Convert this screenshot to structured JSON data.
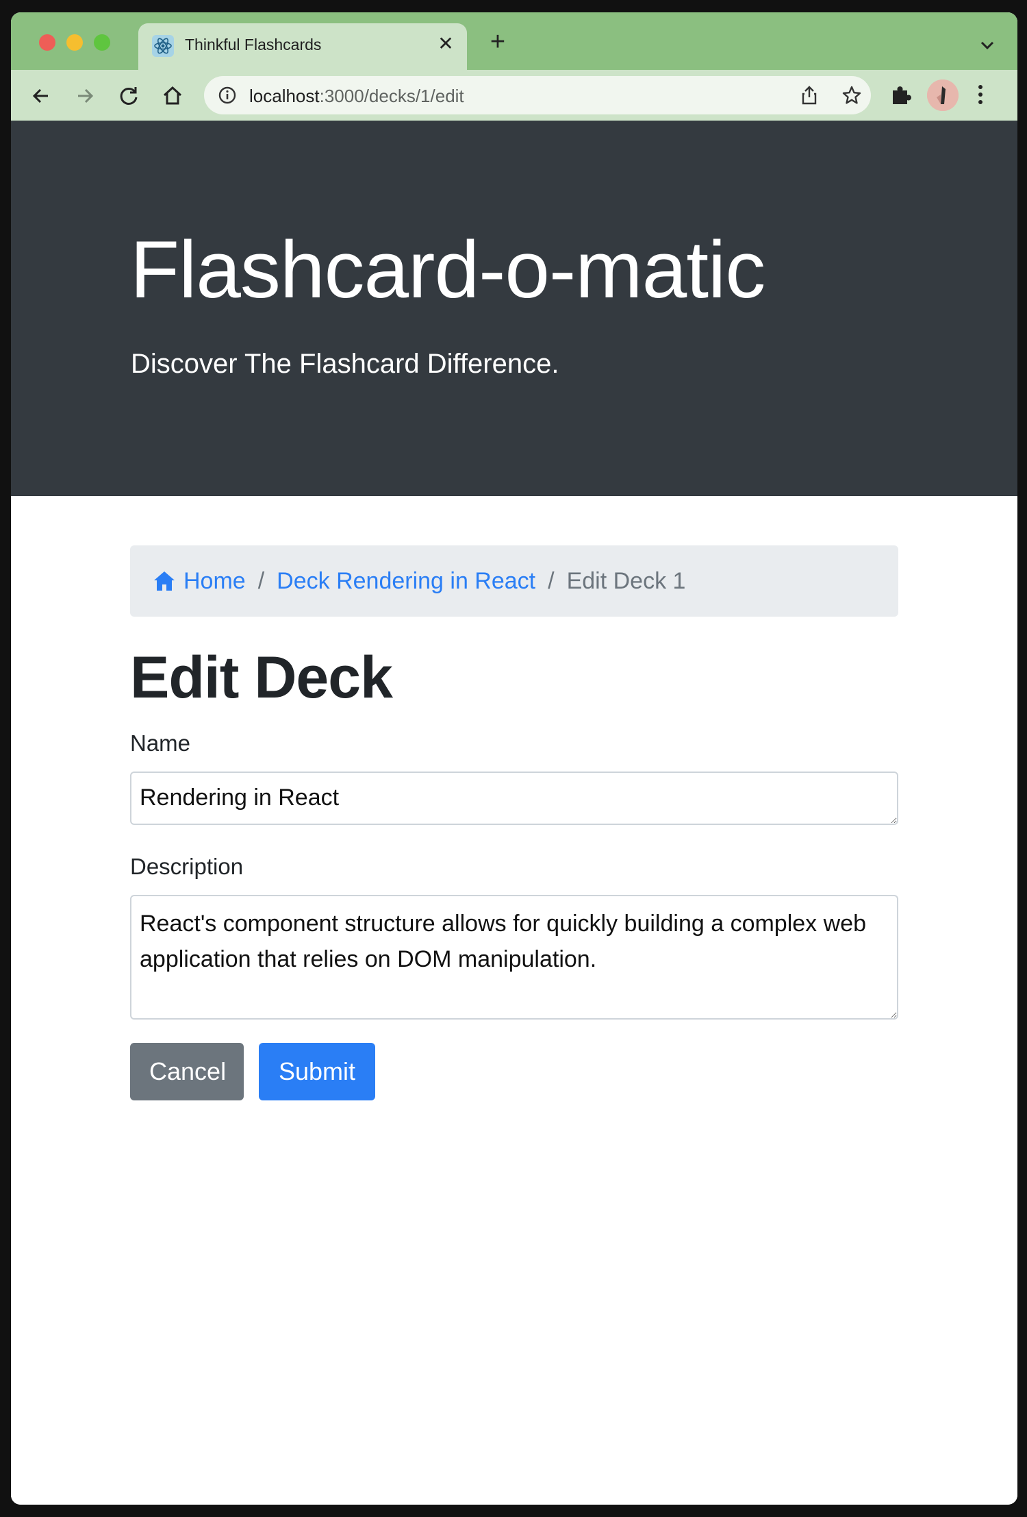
{
  "browser": {
    "tab_title": "Thinkful Flashcards",
    "tab_close": "✕",
    "new_tab": "+",
    "url_host": "localhost",
    "url_path": ":3000/decks/1/edit"
  },
  "jumbotron": {
    "title": "Flashcard-o-matic",
    "subtitle": "Discover The Flashcard Difference."
  },
  "breadcrumb": {
    "home": "Home",
    "deck": "Deck Rendering in React",
    "current": "Edit Deck 1",
    "separator": "/"
  },
  "form": {
    "title": "Edit Deck",
    "name_label": "Name",
    "name_value": "Rendering in React",
    "description_label": "Description",
    "description_value": "React's component structure allows for quickly building a complex web application that relies on DOM manipulation.",
    "cancel_label": "Cancel",
    "submit_label": "Submit"
  },
  "colors": {
    "tab_strip": "#8bbf80",
    "toolbar": "#cde3c8",
    "jumbotron": "#343a40",
    "link": "#2a7ef5",
    "secondary": "#6c757d"
  }
}
